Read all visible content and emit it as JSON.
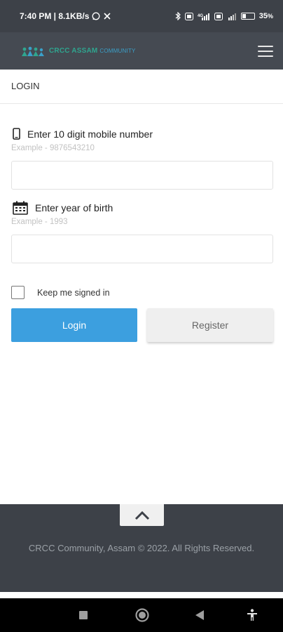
{
  "status_bar": {
    "time_speed": "7:40 PM | 8.1KB/s",
    "battery": "35",
    "battery_level_percent": 35,
    "icons": [
      "whatsapp-icon",
      "fan-icon",
      "bluetooth-icon",
      "volte-icon",
      "signal-icon",
      "volte2-icon",
      "signal2-icon",
      "battery-icon"
    ]
  },
  "header": {
    "logo_primary": "CRCC ASSAM",
    "logo_secondary": "COMMUNITY",
    "logo_color": "#2fa58f",
    "menu_icon": "hamburger-icon"
  },
  "page": {
    "title": "LOGIN"
  },
  "form": {
    "mobile": {
      "icon": "phone-icon",
      "label": "Enter 10 digit mobile number",
      "hint": "Example - 9876543210",
      "value": ""
    },
    "birth_year": {
      "icon": "calendar-icon",
      "label": "Enter year of birth",
      "hint": "Example - 1993",
      "value": ""
    },
    "keep_signed_in": {
      "label": "Keep me signed in",
      "checked": false
    },
    "login_label": "Login",
    "register_label": "Register",
    "accent": "#3c9fdf"
  },
  "footer": {
    "scroll_top_icon": "chevron-up-icon",
    "copyright": "CRCC Community, Assam © 2022. All Rights Reserved."
  },
  "nav_bar": {
    "items": [
      "recents-square-icon",
      "home-circle-icon",
      "back-triangle-icon",
      "accessibility-icon"
    ]
  }
}
